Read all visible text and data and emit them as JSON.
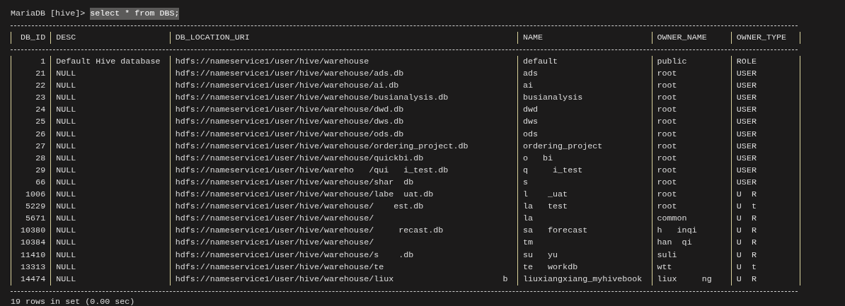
{
  "prompt": {
    "prefix": "MariaDB [hive]>",
    "command": "select * from DBS;"
  },
  "table": {
    "columns": [
      "DB_ID",
      "DESC",
      "DB_LOCATION_URI",
      "NAME",
      "OWNER_NAME",
      "OWNER_TYPE"
    ],
    "rows": [
      [
        "1",
        "Default Hive database",
        "hdfs://nameservice1/user/hive/warehouse",
        "default",
        "public",
        "ROLE"
      ],
      [
        "21",
        "NULL",
        "hdfs://nameservice1/user/hive/warehouse/ads.db",
        "ads",
        "root",
        "USER"
      ],
      [
        "22",
        "NULL",
        "hdfs://nameservice1/user/hive/warehouse/ai.db",
        "ai",
        "root",
        "USER"
      ],
      [
        "23",
        "NULL",
        "hdfs://nameservice1/user/hive/warehouse/busianalysis.db",
        "busianalysis",
        "root",
        "USER"
      ],
      [
        "24",
        "NULL",
        "hdfs://nameservice1/user/hive/warehouse/dwd.db",
        "dwd",
        "root",
        "USER"
      ],
      [
        "25",
        "NULL",
        "hdfs://nameservice1/user/hive/warehouse/dws.db",
        "dws",
        "root",
        "USER"
      ],
      [
        "26",
        "NULL",
        "hdfs://nameservice1/user/hive/warehouse/ods.db",
        "ods",
        "root",
        "USER"
      ],
      [
        "27",
        "NULL",
        "hdfs://nameservice1/user/hive/warehouse/ordering_project.db",
        "ordering_project",
        "root",
        "USER"
      ],
      [
        "28",
        "NULL",
        "hdfs://nameservice1/user/hive/warehouse/quickbi.db",
        "o   bi",
        "root",
        "USER"
      ],
      [
        "29",
        "NULL",
        "hdfs://nameservice1/user/hive/wareho   /qui   i_test.db",
        "q     i_test",
        "root",
        "USER"
      ],
      [
        "66",
        "NULL",
        "hdfs://nameservice1/user/hive/warehouse/shar  db",
        "s",
        "root",
        "USER"
      ],
      [
        "1006",
        "NULL",
        "hdfs://nameservice1/user/hive/warehouse/labe  uat.db",
        "l    _uat",
        "root",
        "U  R"
      ],
      [
        "5229",
        "NULL",
        "hdfs://nameservice1/user/hive/warehouse/    est.db",
        "la   test",
        "root",
        "U  t"
      ],
      [
        "5671",
        "NULL",
        "hdfs://nameservice1/user/hive/warehouse/",
        "la",
        "common",
        "U  R"
      ],
      [
        "10380",
        "NULL",
        "hdfs://nameservice1/user/hive/warehouse/     recast.db",
        "sa   forecast",
        "h   inqi",
        "U  R"
      ],
      [
        "10384",
        "NULL",
        "hdfs://nameservice1/user/hive/warehouse/",
        "tm",
        "han  qi",
        "U  R"
      ],
      [
        "11410",
        "NULL",
        "hdfs://nameservice1/user/hive/warehouse/s    .db",
        "su   yu",
        "suli",
        "U  R"
      ],
      [
        "13313",
        "NULL",
        "hdfs://nameservice1/user/hive/warehouse/te",
        "te   workdb",
        "wtt",
        "U  t"
      ],
      [
        "14474",
        "NULL",
        "hdfs://nameservice1/user/hive/warehouse/liux                      b",
        "liuxiangxiang_myhivebook",
        "liux     ng",
        "U  R"
      ]
    ]
  },
  "status": "19 rows in set (0.00 sec)"
}
